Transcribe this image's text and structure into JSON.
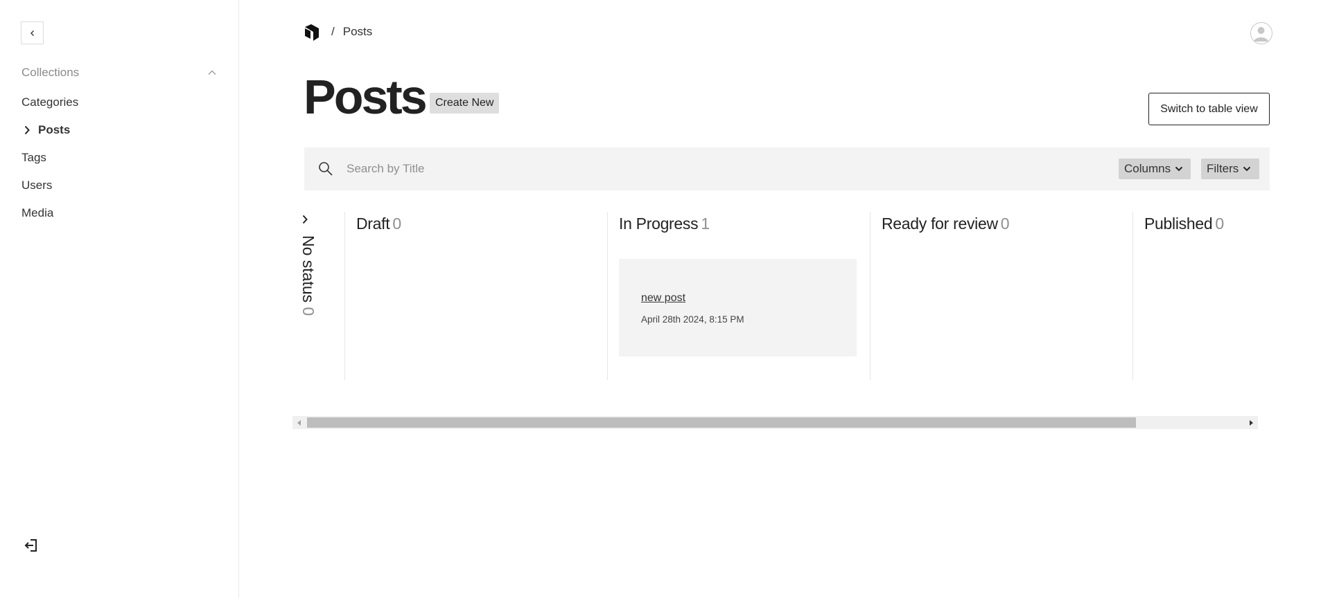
{
  "sidebar": {
    "group_label": "Collections",
    "items": [
      {
        "label": "Categories"
      },
      {
        "label": "Posts"
      },
      {
        "label": "Tags"
      },
      {
        "label": "Users"
      },
      {
        "label": "Media"
      }
    ]
  },
  "header": {
    "breadcrumb_separator": "/",
    "breadcrumb_current": "Posts"
  },
  "page": {
    "title": "Posts",
    "create_label": "Create New",
    "switch_view_label": "Switch to table view"
  },
  "search": {
    "placeholder": "Search by Title",
    "value": "",
    "columns_label": "Columns",
    "filters_label": "Filters"
  },
  "board": {
    "no_status": {
      "label": "No status",
      "count": "0"
    },
    "columns": [
      {
        "title": "Draft",
        "count": "0"
      },
      {
        "title": "In Progress",
        "count": "1"
      },
      {
        "title": "Ready for review",
        "count": "0"
      },
      {
        "title": "Published",
        "count": "0"
      }
    ],
    "card": {
      "title": "new post",
      "date": "April 28th 2024, 8:15 PM"
    }
  },
  "icons": {
    "collapse": "chevron-left-icon",
    "group_toggle": "chevron-up-icon",
    "logout": "logout-icon",
    "search": "search-icon",
    "dropdown": "chevron-down-icon",
    "avatar": "user-avatar-icon",
    "logo": "payload-logo"
  }
}
